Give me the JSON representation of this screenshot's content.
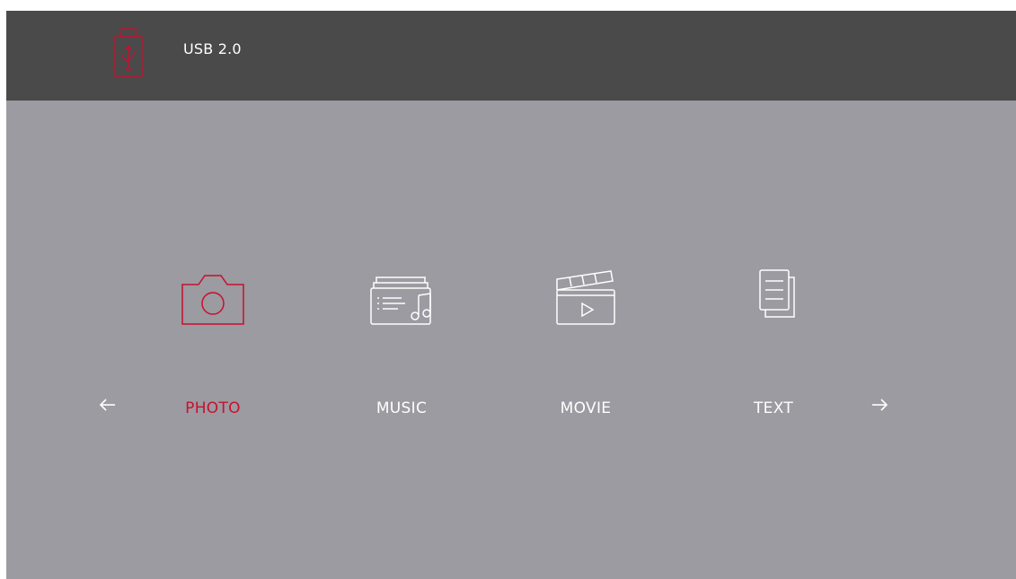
{
  "header": {
    "device_icon": "usb-drive-icon",
    "device_label": "USB 2.0"
  },
  "navigation": {
    "prev_icon": "arrow-left-icon",
    "next_icon": "arrow-right-icon"
  },
  "media_types": [
    {
      "label": "PHOTO",
      "icon": "camera-icon",
      "selected": true
    },
    {
      "label": "MUSIC",
      "icon": "music-library-icon",
      "selected": false
    },
    {
      "label": "MOVIE",
      "icon": "clapperboard-icon",
      "selected": false
    },
    {
      "label": "TEXT",
      "icon": "document-icon",
      "selected": false
    }
  ],
  "colors": {
    "selected": "#c8102e",
    "normal": "#ffffff",
    "background": "#9b9ba1",
    "header": "#4a4a4a"
  }
}
